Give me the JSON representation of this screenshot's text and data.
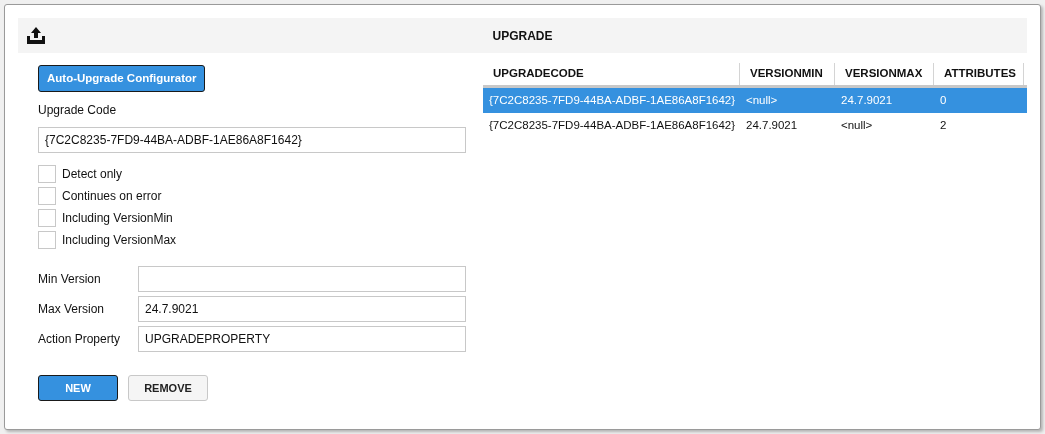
{
  "header": {
    "title": "UPGRADE"
  },
  "configurator_button": "Auto-Upgrade Configurator",
  "upgrade_code": {
    "label": "Upgrade Code",
    "value": "{7C2C8235-7FD9-44BA-ADBF-1AE86A8F1642}"
  },
  "options": [
    {
      "label": "Detect only",
      "checked": false
    },
    {
      "label": "Continues on error",
      "checked": false
    },
    {
      "label": "Including VersionMin",
      "checked": false
    },
    {
      "label": "Including VersionMax",
      "checked": false
    }
  ],
  "fields": [
    {
      "label": "Min Version"
    },
    {
      "label": "Max Version",
      "value": "24.7.9021"
    },
    {
      "label": "Action Property",
      "value": "UPGRADEPROPERTY"
    }
  ],
  "buttons": [
    {
      "label": "NEW",
      "kind": "primary"
    },
    {
      "label": "REMOVE",
      "kind": "secondary"
    }
  ],
  "table": {
    "columns": [
      "UPGRADECODE",
      "VERSIONMIN",
      "VERSIONMAX",
      "ATTRIBUTES"
    ],
    "rows": [
      {
        "cells": [
          "{7C2C8235-7FD9-44BA-ADBF-1AE86A8F1642}",
          "<null>",
          "24.7.9021",
          "0"
        ],
        "selected": true
      },
      {
        "cells": [
          "{7C2C8235-7FD9-44BA-ADBF-1AE86A8F1642}",
          "24.7.9021",
          "<null>",
          "2"
        ],
        "selected": false
      }
    ]
  }
}
